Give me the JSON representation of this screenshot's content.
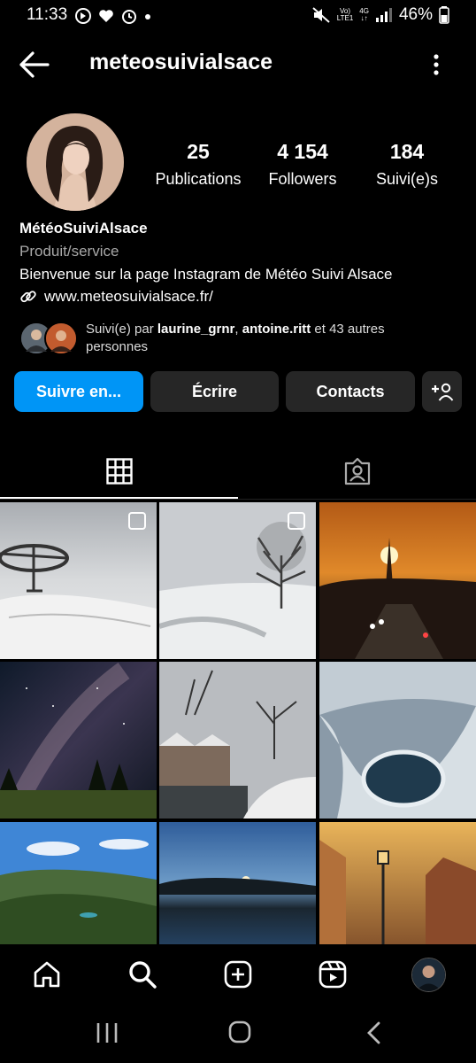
{
  "status_bar": {
    "time": "11:33",
    "network_top": "Vo)",
    "network_bottom": "LTE1",
    "net_type": "4G",
    "battery": "46%"
  },
  "header": {
    "username": "meteosuivialsace"
  },
  "profile": {
    "stats": [
      {
        "value": "25",
        "label": "Publications"
      },
      {
        "value": "4 154",
        "label": "Followers"
      },
      {
        "value": "184",
        "label": "Suivi(e)s"
      }
    ],
    "display_name": "MétéoSuiviAlsace",
    "category": "Produit/service",
    "bio": "Bienvenue sur la page Instagram de Météo Suivi Alsace",
    "website": "www.meteosuivialsace.fr/",
    "mutual": {
      "prefix": "Suivi(e) par ",
      "user1": "laurine_grnr",
      "sep": ", ",
      "user2": "antoine.ritt",
      "suffix": " et 43 autres personnes"
    }
  },
  "actions": {
    "follow": "Suivre en...",
    "message": "Écrire",
    "contacts": "Contacts"
  },
  "tabs": [
    "grid-icon",
    "tagged-icon"
  ],
  "icons": [
    "back-arrow-icon",
    "more-icon",
    "link-icon",
    "add-person-icon",
    "home-icon",
    "search-icon",
    "create-icon",
    "reels-icon",
    "recent-apps-icon",
    "home-button-icon",
    "back-nav-icon"
  ],
  "colors": {
    "accent": "#0095f6",
    "button_bg": "#262626",
    "secondary_text": "#a8a8a8"
  }
}
